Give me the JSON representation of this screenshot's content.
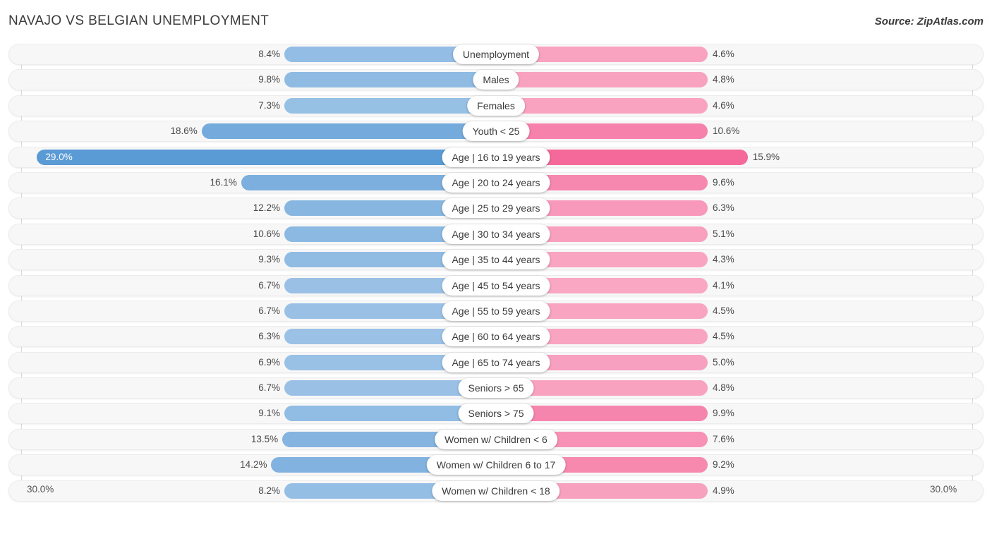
{
  "header": {
    "title": "NAVAJO VS BELGIAN UNEMPLOYMENT",
    "source": "Source: ZipAtlas.com"
  },
  "axis": {
    "left_label": "30.0%",
    "right_label": "30.0%"
  },
  "legend": {
    "items": [
      {
        "label": "Navajo",
        "color": "#5b9bd5"
      },
      {
        "label": "Belgian",
        "color": "#f4689a"
      }
    ]
  },
  "colors": {
    "navajo_light": "#9dc3e6",
    "navajo_dark": "#5b9bd5",
    "belgian_light": "#f9a8c4",
    "belgian_mid": "#f581ab",
    "belgian_dark": "#f4689a",
    "track": "#f7f7f7",
    "gridline": "#d9d9d9"
  },
  "chart_data": {
    "type": "bar",
    "orientation": "horizontal-diverging",
    "title": "NAVAJO VS BELGIAN UNEMPLOYMENT",
    "xlabel": "",
    "ylabel": "",
    "axis_max": 30.0,
    "axis_units": "%",
    "grid": true,
    "legend_position": "bottom-center",
    "categories": [
      "Unemployment",
      "Males",
      "Females",
      "Youth < 25",
      "Age | 16 to 19 years",
      "Age | 20 to 24 years",
      "Age | 25 to 29 years",
      "Age | 30 to 34 years",
      "Age | 35 to 44 years",
      "Age | 45 to 54 years",
      "Age | 55 to 59 years",
      "Age | 60 to 64 years",
      "Age | 65 to 74 years",
      "Seniors > 65",
      "Seniors > 75",
      "Women w/ Children < 6",
      "Women w/ Children 6 to 17",
      "Women w/ Children < 18"
    ],
    "series": [
      {
        "name": "Navajo",
        "values": [
          8.4,
          9.8,
          7.3,
          18.6,
          29.0,
          16.1,
          12.2,
          10.6,
          9.3,
          6.7,
          6.7,
          6.3,
          6.9,
          6.7,
          9.1,
          13.5,
          14.2,
          8.2
        ],
        "labels": [
          "8.4%",
          "9.8%",
          "7.3%",
          "18.6%",
          "29.0%",
          "16.1%",
          "12.2%",
          "10.6%",
          "9.3%",
          "6.7%",
          "6.7%",
          "6.3%",
          "6.9%",
          "6.7%",
          "9.1%",
          "13.5%",
          "14.2%",
          "8.2%"
        ]
      },
      {
        "name": "Belgian",
        "values": [
          4.6,
          4.8,
          4.6,
          10.6,
          15.9,
          9.6,
          6.3,
          5.1,
          4.3,
          4.1,
          4.5,
          4.5,
          5.0,
          4.8,
          9.9,
          7.6,
          9.2,
          4.9
        ],
        "labels": [
          "4.6%",
          "4.8%",
          "4.6%",
          "10.6%",
          "15.9%",
          "9.6%",
          "6.3%",
          "5.1%",
          "4.3%",
          "4.1%",
          "4.5%",
          "4.5%",
          "5.0%",
          "4.8%",
          "9.9%",
          "7.6%",
          "9.2%",
          "4.9%"
        ]
      }
    ]
  }
}
